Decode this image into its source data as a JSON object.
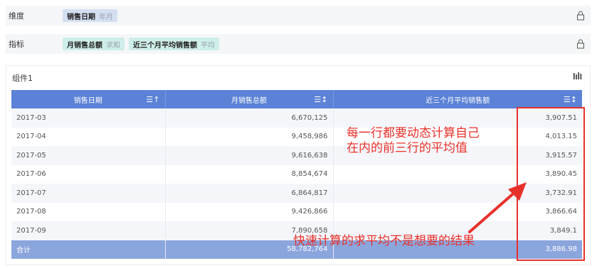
{
  "filters": {
    "dimension": {
      "label": "维度",
      "chips": [
        {
          "name": "销售日期",
          "sub": "年月"
        }
      ]
    },
    "metrics": {
      "label": "指标",
      "chips": [
        {
          "name": "月销售总额",
          "sub": "求和"
        },
        {
          "name": "近三个月平均销售额",
          "sub": "平均"
        }
      ]
    }
  },
  "panel": {
    "title": "组件1"
  },
  "table": {
    "headers": [
      "销售日期",
      "月销售总额",
      "近三个月平均销售额"
    ],
    "rows": [
      [
        "2017-03",
        "6,670,125",
        "3,907.51"
      ],
      [
        "2017-04",
        "9,458,986",
        "4,013.15"
      ],
      [
        "2017-05",
        "9,616,638",
        "3,915.57"
      ],
      [
        "2017-06",
        "8,854,674",
        "3,890.45"
      ],
      [
        "2017-07",
        "6,864,817",
        "3,732.91"
      ],
      [
        "2017-08",
        "9,426,866",
        "3,866.64"
      ],
      [
        "2017-09",
        "7,890,658",
        "3,849.1"
      ]
    ],
    "total": [
      "合计",
      "58,782,764",
      "3,886.98"
    ]
  },
  "annotations": {
    "note1_line1": "每一行都要动态计算自己",
    "note1_line2": "在内的前三行的平均值",
    "note2": "快速计算的求平均不是想要的结果"
  },
  "colors": {
    "header": "#5b82d6",
    "total_row": "#8ba5dd",
    "annotation": "#e8302a"
  }
}
